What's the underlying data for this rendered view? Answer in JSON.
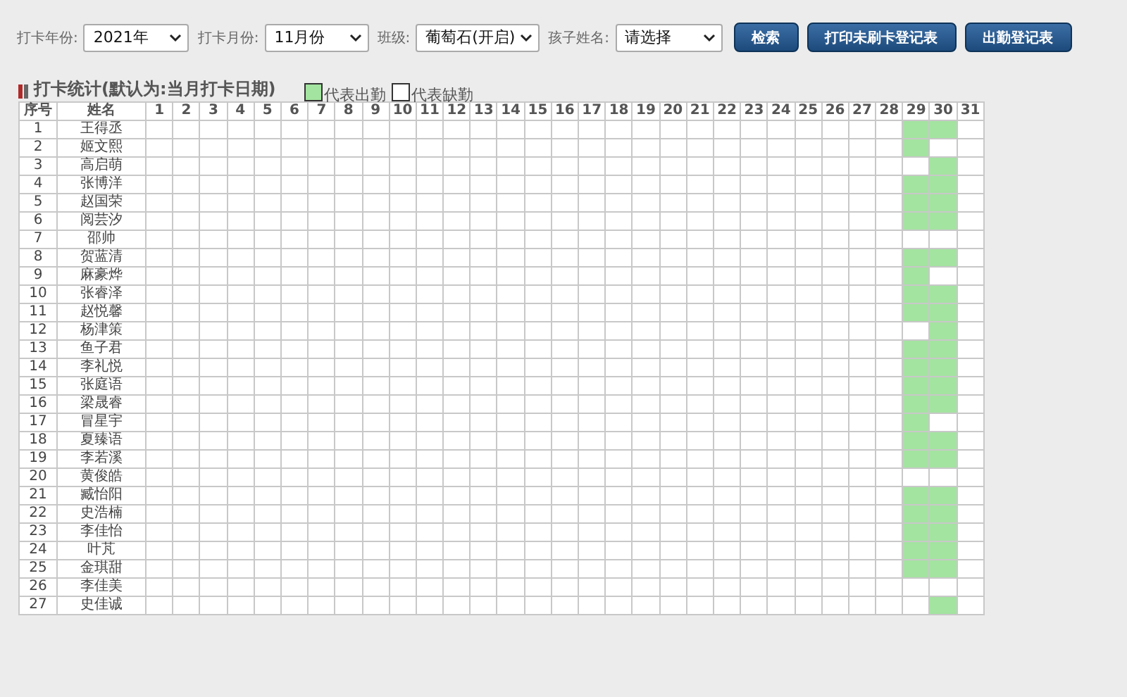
{
  "filters": [
    {
      "label": "打卡年份:",
      "value": "2021年"
    },
    {
      "label": "打卡月份:",
      "value": "11月份"
    },
    {
      "label": "班级:",
      "value": "葡萄石(开启)"
    },
    {
      "label": "孩子姓名:",
      "value": "请选择"
    }
  ],
  "buttons": [
    "检索",
    "打印未刷卡登记表",
    "出勤登记表"
  ],
  "section_title": "打卡统计(默认为:当月打卡日期)",
  "legend": [
    {
      "label": "代表出勤",
      "present": true
    },
    {
      "label": "代表缺勤",
      "present": false
    }
  ],
  "table": {
    "columns": [
      "序号",
      "姓名",
      "1",
      "2",
      "3",
      "4",
      "5",
      "6",
      "7",
      "8",
      "9",
      "10",
      "11",
      "12",
      "13",
      "14",
      "15",
      "16",
      "17",
      "18",
      "19",
      "20",
      "21",
      "22",
      "23",
      "24",
      "25",
      "26",
      "27",
      "28",
      "29",
      "30",
      "31"
    ],
    "rows": [
      {
        "no": "1",
        "name": "王得丞",
        "attendance": [
          false,
          false,
          false,
          false,
          false,
          false,
          false,
          false,
          false,
          false,
          false,
          false,
          false,
          false,
          false,
          false,
          false,
          false,
          false,
          false,
          false,
          false,
          false,
          false,
          false,
          false,
          false,
          false,
          true,
          true,
          false
        ]
      },
      {
        "no": "2",
        "name": "姬文熙",
        "attendance": [
          false,
          false,
          false,
          false,
          false,
          false,
          false,
          false,
          false,
          false,
          false,
          false,
          false,
          false,
          false,
          false,
          false,
          false,
          false,
          false,
          false,
          false,
          false,
          false,
          false,
          false,
          false,
          false,
          true,
          false,
          false
        ]
      },
      {
        "no": "3",
        "name": "高启萌",
        "attendance": [
          false,
          false,
          false,
          false,
          false,
          false,
          false,
          false,
          false,
          false,
          false,
          false,
          false,
          false,
          false,
          false,
          false,
          false,
          false,
          false,
          false,
          false,
          false,
          false,
          false,
          false,
          false,
          false,
          false,
          true,
          false
        ]
      },
      {
        "no": "4",
        "name": "张博洋",
        "attendance": [
          false,
          false,
          false,
          false,
          false,
          false,
          false,
          false,
          false,
          false,
          false,
          false,
          false,
          false,
          false,
          false,
          false,
          false,
          false,
          false,
          false,
          false,
          false,
          false,
          false,
          false,
          false,
          false,
          true,
          true,
          false
        ]
      },
      {
        "no": "5",
        "name": "赵国荣",
        "attendance": [
          false,
          false,
          false,
          false,
          false,
          false,
          false,
          false,
          false,
          false,
          false,
          false,
          false,
          false,
          false,
          false,
          false,
          false,
          false,
          false,
          false,
          false,
          false,
          false,
          false,
          false,
          false,
          false,
          true,
          true,
          false
        ]
      },
      {
        "no": "6",
        "name": "阅芸汐",
        "attendance": [
          false,
          false,
          false,
          false,
          false,
          false,
          false,
          false,
          false,
          false,
          false,
          false,
          false,
          false,
          false,
          false,
          false,
          false,
          false,
          false,
          false,
          false,
          false,
          false,
          false,
          false,
          false,
          false,
          true,
          true,
          false
        ]
      },
      {
        "no": "7",
        "name": "邵帅",
        "attendance": [
          false,
          false,
          false,
          false,
          false,
          false,
          false,
          false,
          false,
          false,
          false,
          false,
          false,
          false,
          false,
          false,
          false,
          false,
          false,
          false,
          false,
          false,
          false,
          false,
          false,
          false,
          false,
          false,
          false,
          false,
          false
        ]
      },
      {
        "no": "8",
        "name": "贺蓝清",
        "attendance": [
          false,
          false,
          false,
          false,
          false,
          false,
          false,
          false,
          false,
          false,
          false,
          false,
          false,
          false,
          false,
          false,
          false,
          false,
          false,
          false,
          false,
          false,
          false,
          false,
          false,
          false,
          false,
          false,
          true,
          true,
          false
        ]
      },
      {
        "no": "9",
        "name": "麻豪烨",
        "attendance": [
          false,
          false,
          false,
          false,
          false,
          false,
          false,
          false,
          false,
          false,
          false,
          false,
          false,
          false,
          false,
          false,
          false,
          false,
          false,
          false,
          false,
          false,
          false,
          false,
          false,
          false,
          false,
          false,
          true,
          false,
          false
        ]
      },
      {
        "no": "10",
        "name": "张睿泽",
        "attendance": [
          false,
          false,
          false,
          false,
          false,
          false,
          false,
          false,
          false,
          false,
          false,
          false,
          false,
          false,
          false,
          false,
          false,
          false,
          false,
          false,
          false,
          false,
          false,
          false,
          false,
          false,
          false,
          false,
          true,
          true,
          false
        ]
      },
      {
        "no": "11",
        "name": "赵悦馨",
        "attendance": [
          false,
          false,
          false,
          false,
          false,
          false,
          false,
          false,
          false,
          false,
          false,
          false,
          false,
          false,
          false,
          false,
          false,
          false,
          false,
          false,
          false,
          false,
          false,
          false,
          false,
          false,
          false,
          false,
          true,
          true,
          false
        ]
      },
      {
        "no": "12",
        "name": "杨津策",
        "attendance": [
          false,
          false,
          false,
          false,
          false,
          false,
          false,
          false,
          false,
          false,
          false,
          false,
          false,
          false,
          false,
          false,
          false,
          false,
          false,
          false,
          false,
          false,
          false,
          false,
          false,
          false,
          false,
          false,
          false,
          true,
          false
        ]
      },
      {
        "no": "13",
        "name": "鱼子君",
        "attendance": [
          false,
          false,
          false,
          false,
          false,
          false,
          false,
          false,
          false,
          false,
          false,
          false,
          false,
          false,
          false,
          false,
          false,
          false,
          false,
          false,
          false,
          false,
          false,
          false,
          false,
          false,
          false,
          false,
          true,
          true,
          false
        ]
      },
      {
        "no": "14",
        "name": "李礼悦",
        "attendance": [
          false,
          false,
          false,
          false,
          false,
          false,
          false,
          false,
          false,
          false,
          false,
          false,
          false,
          false,
          false,
          false,
          false,
          false,
          false,
          false,
          false,
          false,
          false,
          false,
          false,
          false,
          false,
          false,
          true,
          true,
          false
        ]
      },
      {
        "no": "15",
        "name": "张庭语",
        "attendance": [
          false,
          false,
          false,
          false,
          false,
          false,
          false,
          false,
          false,
          false,
          false,
          false,
          false,
          false,
          false,
          false,
          false,
          false,
          false,
          false,
          false,
          false,
          false,
          false,
          false,
          false,
          false,
          false,
          true,
          true,
          false
        ]
      },
      {
        "no": "16",
        "name": "梁晟睿",
        "attendance": [
          false,
          false,
          false,
          false,
          false,
          false,
          false,
          false,
          false,
          false,
          false,
          false,
          false,
          false,
          false,
          false,
          false,
          false,
          false,
          false,
          false,
          false,
          false,
          false,
          false,
          false,
          false,
          false,
          true,
          true,
          false
        ]
      },
      {
        "no": "17",
        "name": "冒星宇",
        "attendance": [
          false,
          false,
          false,
          false,
          false,
          false,
          false,
          false,
          false,
          false,
          false,
          false,
          false,
          false,
          false,
          false,
          false,
          false,
          false,
          false,
          false,
          false,
          false,
          false,
          false,
          false,
          false,
          false,
          true,
          false,
          false
        ]
      },
      {
        "no": "18",
        "name": "夏臻语",
        "attendance": [
          false,
          false,
          false,
          false,
          false,
          false,
          false,
          false,
          false,
          false,
          false,
          false,
          false,
          false,
          false,
          false,
          false,
          false,
          false,
          false,
          false,
          false,
          false,
          false,
          false,
          false,
          false,
          false,
          true,
          true,
          false
        ]
      },
      {
        "no": "19",
        "name": "李若溪",
        "attendance": [
          false,
          false,
          false,
          false,
          false,
          false,
          false,
          false,
          false,
          false,
          false,
          false,
          false,
          false,
          false,
          false,
          false,
          false,
          false,
          false,
          false,
          false,
          false,
          false,
          false,
          false,
          false,
          false,
          true,
          true,
          false
        ]
      },
      {
        "no": "20",
        "name": "黄俊皓",
        "attendance": [
          false,
          false,
          false,
          false,
          false,
          false,
          false,
          false,
          false,
          false,
          false,
          false,
          false,
          false,
          false,
          false,
          false,
          false,
          false,
          false,
          false,
          false,
          false,
          false,
          false,
          false,
          false,
          false,
          false,
          false,
          false
        ]
      },
      {
        "no": "21",
        "name": "臧怡阳",
        "attendance": [
          false,
          false,
          false,
          false,
          false,
          false,
          false,
          false,
          false,
          false,
          false,
          false,
          false,
          false,
          false,
          false,
          false,
          false,
          false,
          false,
          false,
          false,
          false,
          false,
          false,
          false,
          false,
          false,
          true,
          true,
          false
        ]
      },
      {
        "no": "22",
        "name": "史浩楠",
        "attendance": [
          false,
          false,
          false,
          false,
          false,
          false,
          false,
          false,
          false,
          false,
          false,
          false,
          false,
          false,
          false,
          false,
          false,
          false,
          false,
          false,
          false,
          false,
          false,
          false,
          false,
          false,
          false,
          false,
          true,
          true,
          false
        ]
      },
      {
        "no": "23",
        "name": "李佳怡",
        "attendance": [
          false,
          false,
          false,
          false,
          false,
          false,
          false,
          false,
          false,
          false,
          false,
          false,
          false,
          false,
          false,
          false,
          false,
          false,
          false,
          false,
          false,
          false,
          false,
          false,
          false,
          false,
          false,
          false,
          true,
          true,
          false
        ]
      },
      {
        "no": "24",
        "name": "叶芃",
        "attendance": [
          false,
          false,
          false,
          false,
          false,
          false,
          false,
          false,
          false,
          false,
          false,
          false,
          false,
          false,
          false,
          false,
          false,
          false,
          false,
          false,
          false,
          false,
          false,
          false,
          false,
          false,
          false,
          false,
          true,
          true,
          false
        ]
      },
      {
        "no": "25",
        "name": "金琪甜",
        "attendance": [
          false,
          false,
          false,
          false,
          false,
          false,
          false,
          false,
          false,
          false,
          false,
          false,
          false,
          false,
          false,
          false,
          false,
          false,
          false,
          false,
          false,
          false,
          false,
          false,
          false,
          false,
          false,
          false,
          true,
          true,
          false
        ]
      },
      {
        "no": "26",
        "name": "李佳美",
        "attendance": [
          false,
          false,
          false,
          false,
          false,
          false,
          false,
          false,
          false,
          false,
          false,
          false,
          false,
          false,
          false,
          false,
          false,
          false,
          false,
          false,
          false,
          false,
          false,
          false,
          false,
          false,
          false,
          false,
          false,
          false,
          false
        ]
      },
      {
        "no": "27",
        "name": "史佳诚",
        "attendance": [
          false,
          false,
          false,
          false,
          false,
          false,
          false,
          false,
          false,
          false,
          false,
          false,
          false,
          false,
          false,
          false,
          false,
          false,
          false,
          false,
          false,
          false,
          false,
          false,
          false,
          false,
          false,
          false,
          false,
          true,
          false
        ]
      }
    ]
  }
}
